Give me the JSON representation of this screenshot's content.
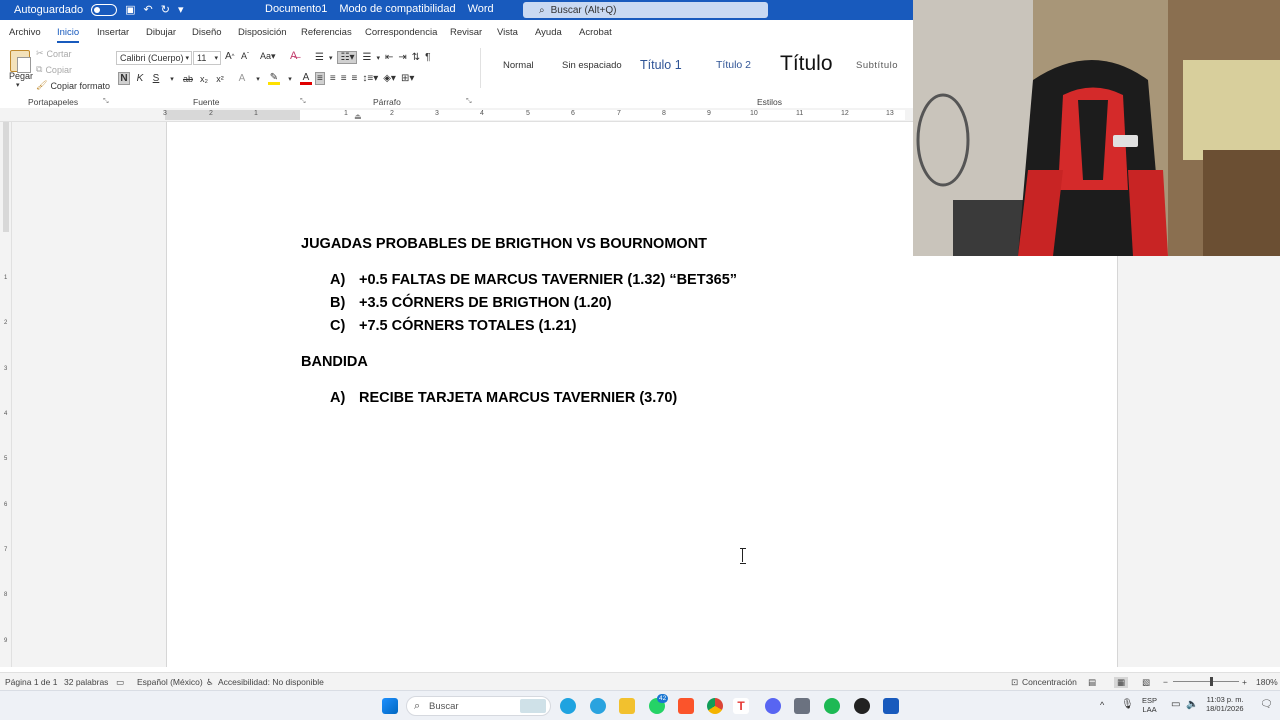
{
  "titlebar": {
    "autosave": "Autoguardado",
    "document_name": "Documento1",
    "mode": "Modo de compatibilidad",
    "app": "Word",
    "search_placeholder": "Buscar (Alt+Q)"
  },
  "tabs": [
    "Archivo",
    "Inicio",
    "Insertar",
    "Dibujar",
    "Diseño",
    "Disposición",
    "Referencias",
    "Correspondencia",
    "Revisar",
    "Vista",
    "Ayuda",
    "Acrobat"
  ],
  "ribbon": {
    "clipboard": {
      "paste": "Pegar",
      "cut": "Cortar",
      "copy": "Copiar",
      "format_painter": "Copiar formato",
      "label": "Portapapeles"
    },
    "font": {
      "name": "Calibri (Cuerpo)",
      "size": "11",
      "bold": "N",
      "italic": "K",
      "underline": "S",
      "label": "Fuente"
    },
    "paragraph": {
      "label": "Párrafo"
    },
    "styles": {
      "items": [
        "Normal",
        "Sin espaciado",
        "Título 1",
        "Título 2",
        "Título",
        "Subtítulo"
      ],
      "label": "Estilos"
    }
  },
  "ruler": {
    "h_numbers": [
      "3",
      "2",
      "1",
      "1",
      "2",
      "3",
      "4",
      "5",
      "6",
      "7",
      "8",
      "9",
      "10",
      "11",
      "12",
      "13"
    ],
    "v_numbers": [
      "1",
      "2",
      "3",
      "4",
      "5",
      "6",
      "7",
      "8",
      "9"
    ]
  },
  "document": {
    "heading1": "JUGADAS PROBABLES DE BRIGTHON VS BOURNOMONT",
    "list1": [
      {
        "marker": "A)",
        "text": "+0.5 FALTAS DE MARCUS TAVERNIER (1.32) “BET365”"
      },
      {
        "marker": "B)",
        "text": "+3.5 CÓRNERS DE BRIGTHON (1.20)"
      },
      {
        "marker": "C)",
        "text": "+7.5 CÓRNERS TOTALES (1.21)"
      }
    ],
    "heading2": "BANDIDA",
    "list2": [
      {
        "marker": "A)",
        "text": "RECIBE TARJETA MARCUS TAVERNIER (3.70)"
      }
    ]
  },
  "statusbar": {
    "page": "Página 1 de 1",
    "words": "32 palabras",
    "language": "Español (México)",
    "accessibility": "Accesibilidad: No disponible",
    "focus": "Concentración",
    "zoom": "180%"
  },
  "taskbar": {
    "search": "Buscar",
    "badge": "42",
    "lang_top": "ESP",
    "lang_bottom": "LAA",
    "time": "11:03 p. m.",
    "date": "18/01/2026"
  },
  "colors": {
    "word_blue": "#185abd",
    "ribbon_bg": "#ffffff",
    "canvas_bg": "#f3f3f3"
  }
}
